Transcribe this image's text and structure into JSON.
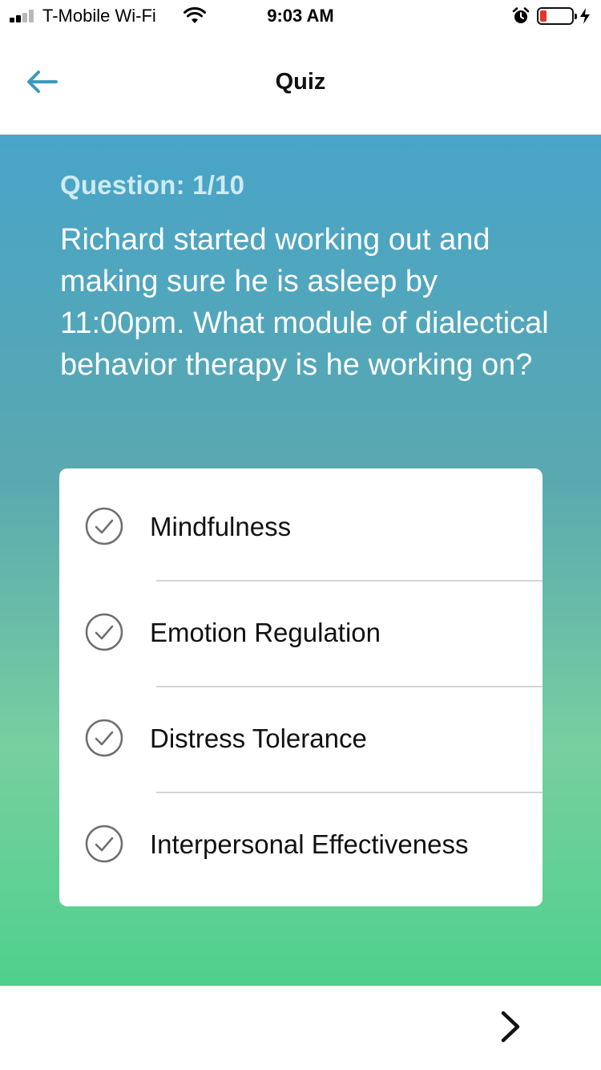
{
  "status_bar": {
    "carrier": "T-Mobile Wi-Fi",
    "time": "9:03 AM",
    "icons": [
      "signal-icon",
      "wifi-icon",
      "alarm-icon",
      "battery-icon",
      "charging-bolt-icon"
    ]
  },
  "nav": {
    "title": "Quiz",
    "back_icon": "back-arrow-icon",
    "accent_color": "#3b9bbf"
  },
  "quiz": {
    "counter": "Question: 1/10",
    "question": "Richard started working out and making sure he is asleep by 11:00pm. What module of dialectical behavior therapy is he working on?",
    "answers": [
      {
        "label": "Mindfulness",
        "icon": "check-circle-icon"
      },
      {
        "label": "Emotion Regulation",
        "icon": "check-circle-icon"
      },
      {
        "label": "Distress Tolerance",
        "icon": "check-circle-icon"
      },
      {
        "label": "Interpersonal Effectiveness",
        "icon": "check-circle-icon"
      }
    ]
  },
  "footer": {
    "next_icon": "chevron-right-icon"
  },
  "colors": {
    "gradient_top": "#48a4c8",
    "gradient_bottom": "#4fd08c",
    "battery_low": "#e8352b"
  }
}
